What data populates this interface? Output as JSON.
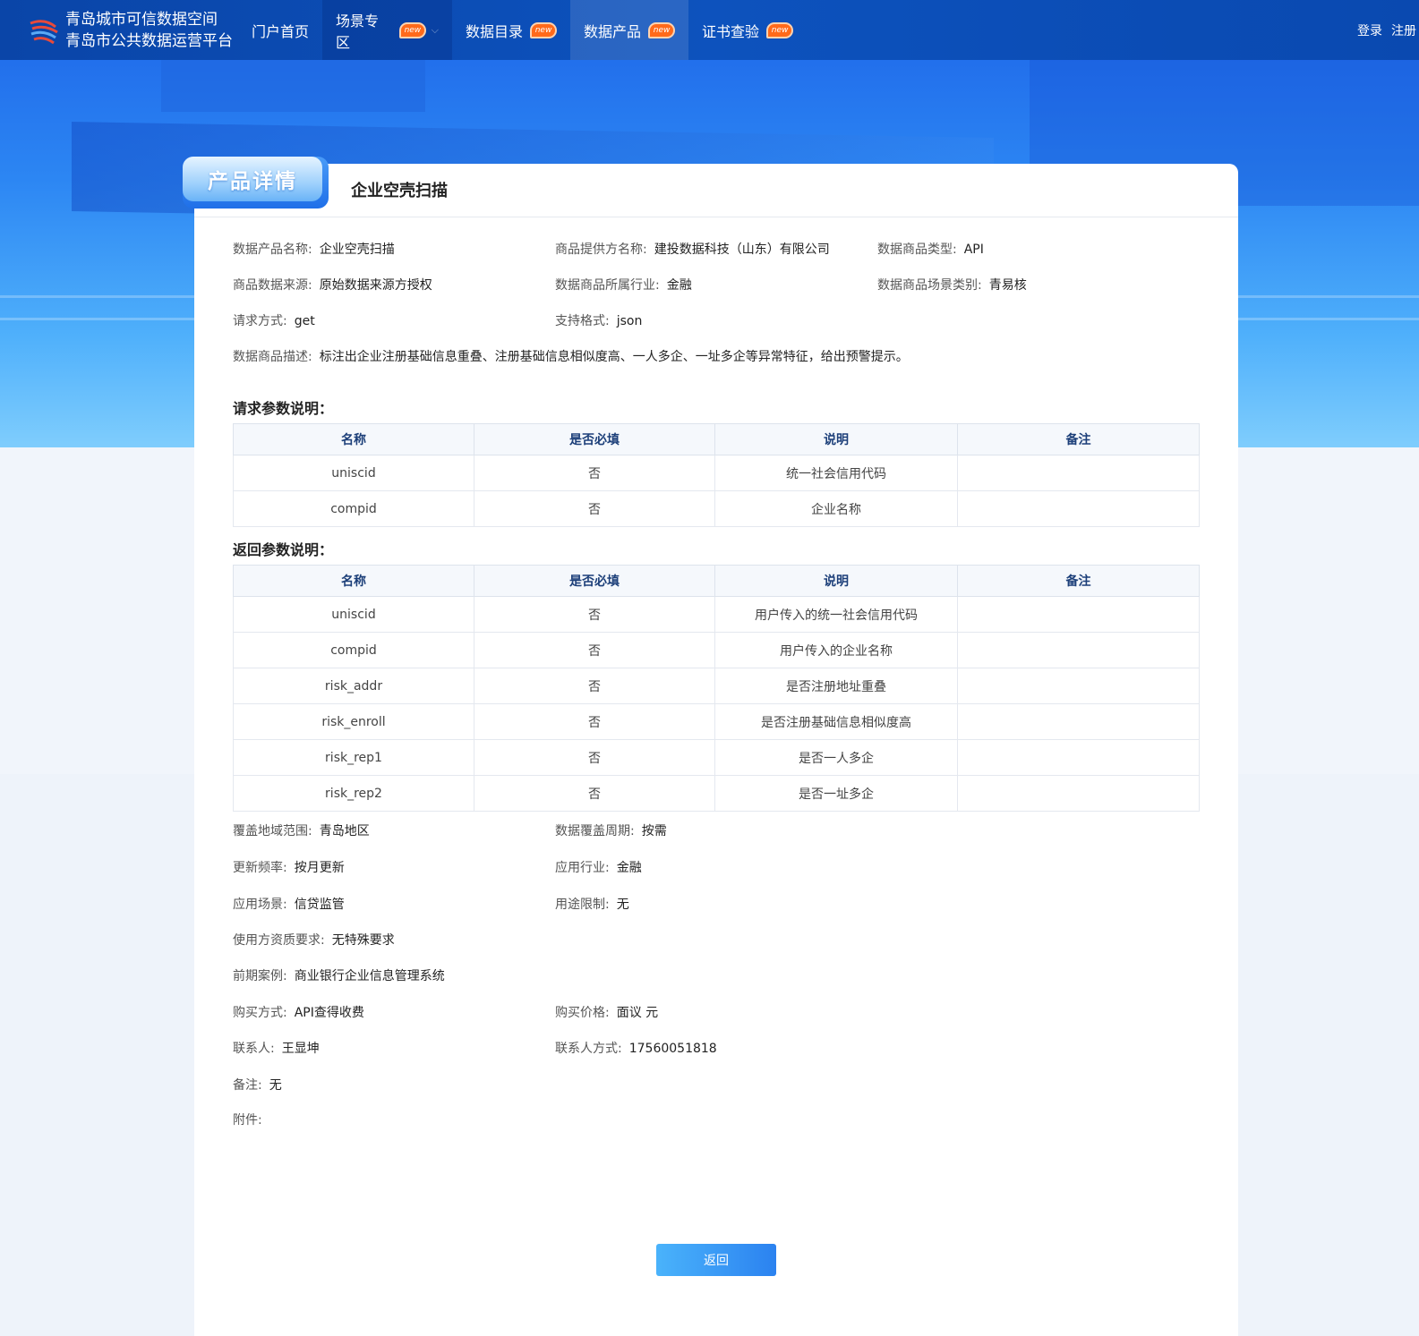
{
  "header": {
    "brand_line1": "青岛城市可信数据空间",
    "brand_line2": "青岛市公共数据运营平台",
    "nav": [
      {
        "label": "门户首页",
        "new": false
      },
      {
        "label": "场景专区",
        "new": true,
        "new_label": "new"
      },
      {
        "label": "数据目录",
        "new": true,
        "new_label": "new"
      },
      {
        "label": "数据产品",
        "new": true,
        "new_label": "new"
      },
      {
        "label": "证书查验",
        "new": true,
        "new_label": "new"
      }
    ],
    "active_nav": "数据产品",
    "login": "登录",
    "register": "注册"
  },
  "tab_label": "产品详情",
  "product_title": "企业空壳扫描",
  "info": {
    "name_label": "数据产品名称:",
    "name": "企业空壳扫描",
    "provider_label": "商品提供方名称:",
    "provider": "建投数据科技（山东）有限公司",
    "type_label": "数据商品类型:",
    "type": "API",
    "source_label": "商品数据来源:",
    "source": "原始数据来源方授权",
    "industry_label": "数据商品所属行业:",
    "industry": "金融",
    "scene_label": "数据商品场景类别:",
    "scene": "青易核",
    "method_label": "请求方式:",
    "method": "get",
    "format_label": "支持格式:",
    "format": "json",
    "desc_label": "数据商品描述:",
    "desc": "标注出企业注册基础信息重叠、注册基础信息相似度高、一人多企、一址多企等异常特征，给出预警提示。"
  },
  "request_params": {
    "title": "请求参数说明：",
    "headers": [
      "名称",
      "是否必填",
      "说明",
      "备注"
    ],
    "rows": [
      [
        "uniscid",
        "否",
        "统一社会信用代码",
        ""
      ],
      [
        "compid",
        "否",
        "企业名称",
        ""
      ]
    ]
  },
  "response_params": {
    "title": "返回参数说明：",
    "headers": [
      "名称",
      "是否必填",
      "说明",
      "备注"
    ],
    "rows": [
      [
        "uniscid",
        "否",
        "用户传入的统一社会信用代码",
        ""
      ],
      [
        "compid",
        "否",
        "用户传入的企业名称",
        ""
      ],
      [
        "risk_addr",
        "否",
        "是否注册地址重叠",
        ""
      ],
      [
        "risk_enroll",
        "否",
        "是否注册基础信息相似度高",
        ""
      ],
      [
        "risk_rep1",
        "否",
        "是否一人多企",
        ""
      ],
      [
        "risk_rep2",
        "否",
        "是否一址多企",
        ""
      ]
    ]
  },
  "extra": {
    "region_label": "覆盖地域范围:",
    "region": "青岛地区",
    "cycle_label": "数据覆盖周期:",
    "cycle": "按需",
    "freq_label": "更新频率:",
    "freq": "按月更新",
    "app_industry_label": "应用行业:",
    "app_industry": "金融",
    "app_scene_label": "应用场景:",
    "app_scene": "信贷监管",
    "limit_label": "用途限制:",
    "limit": "无",
    "qual_label": "使用方资质要求:",
    "qual": "无特殊要求",
    "case_label": "前期案例:",
    "case": "商业银行企业信息管理系统",
    "buy_label": "购买方式:",
    "buy": "API查得收费",
    "price_label": "购买价格:",
    "price": "面议 元",
    "contact_label": "联系人:",
    "contact": "王显坤",
    "phone_label": "联系人方式:",
    "phone": "17560051818",
    "note_label": "备注:",
    "note": "无",
    "attach_label": "附件:"
  },
  "back_button": "返回",
  "colors": {
    "header": "#0d52bd",
    "accent": "#2b82f0",
    "badge": "#ff6a1a"
  }
}
